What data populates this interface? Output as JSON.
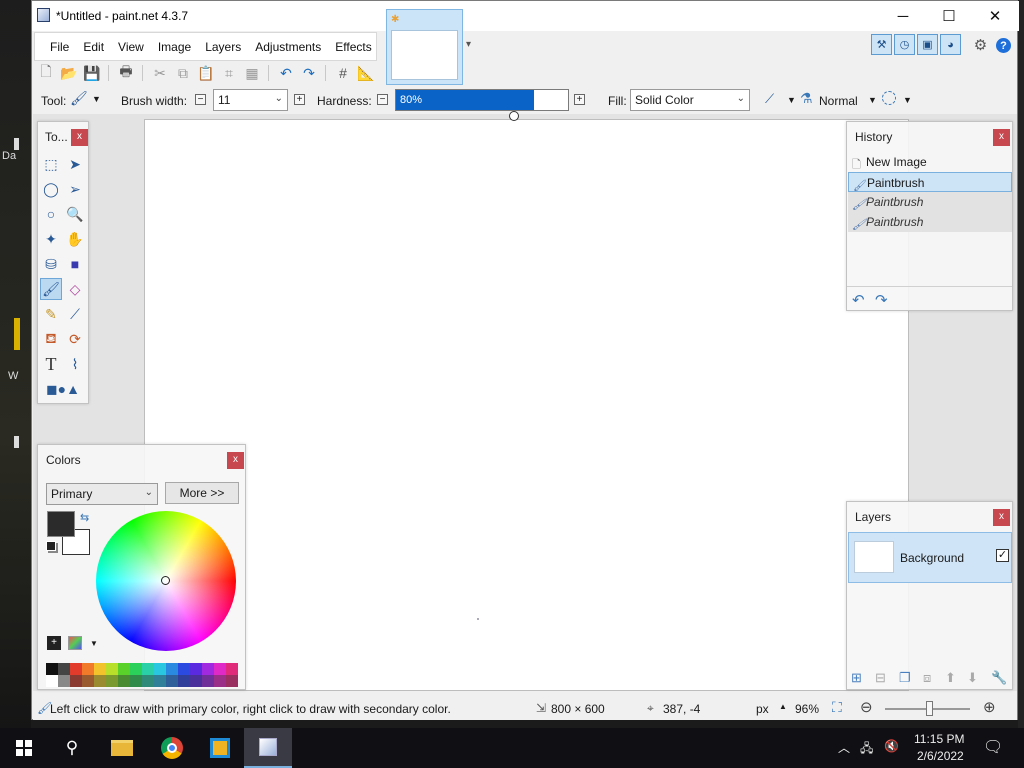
{
  "window": {
    "title": "*Untitled - paint.net 4.3.7",
    "minimize": "─",
    "maximize": "☐",
    "close": "✕"
  },
  "desktop": {
    "left_text_1": "Da",
    "left_text_2": "W"
  },
  "menu": [
    "File",
    "Edit",
    "View",
    "Image",
    "Layers",
    "Adjustments",
    "Effects"
  ],
  "toolbar2": {
    "tool_label": "Tool:",
    "brush_width_label": "Brush width:",
    "brush_width_value": "11",
    "hardness_label": "Hardness:",
    "hardness_value": "80%",
    "hardness_level": 0.8,
    "fill_label": "Fill:",
    "fill_value": "Solid Color",
    "blend_value": "Normal"
  },
  "tools_panel": {
    "title": "To...",
    "close": "x"
  },
  "history_panel": {
    "title": "History",
    "close": "x",
    "items": [
      {
        "label": "New Image",
        "state": "normal"
      },
      {
        "label": "Paintbrush",
        "state": "selected"
      },
      {
        "label": "Paintbrush",
        "state": "undone"
      },
      {
        "label": "Paintbrush",
        "state": "undone"
      }
    ]
  },
  "colors_panel": {
    "title": "Colors",
    "close": "x",
    "mode_value": "Primary",
    "more_button": "More >>",
    "primary_color": "#2b2b2b",
    "secondary_color": "#ffffff"
  },
  "layers_panel": {
    "title": "Layers",
    "close": "x",
    "layer_name": "Background",
    "visible": true
  },
  "status": {
    "hint": "Left click to draw with primary color, right click to draw with secondary color.",
    "image_size": "800 × 600",
    "cursor_pos": "387, -4",
    "units": "px",
    "zoom": "96%"
  },
  "taskbar": {
    "time": "11:15 PM",
    "date": "2/6/2022"
  },
  "colors": {
    "accent": "#0a64c8",
    "close_red": "#c7484f",
    "selected_blue": "#cce4f7"
  }
}
